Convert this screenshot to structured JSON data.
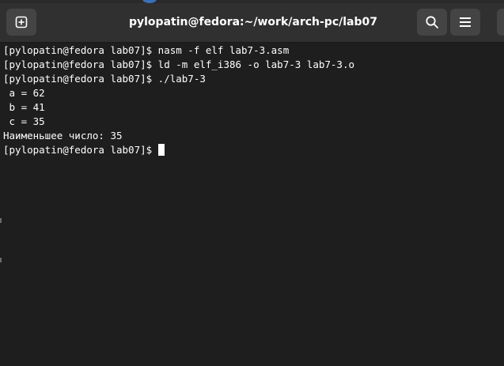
{
  "window": {
    "title": "pylopatin@fedora:~/work/arch-pc/lab07"
  },
  "headerbar": {
    "new_tab_icon": "new-tab-icon",
    "search_icon": "search-icon",
    "menu_icon": "hamburger-menu-icon"
  },
  "terminal": {
    "lines": [
      "[pylopatin@fedora lab07]$ nasm -f elf lab7-3.asm",
      "[pylopatin@fedora lab07]$ ld -m elf_i386 -o lab7-3 lab7-3.o",
      "[pylopatin@fedora lab07]$ ./lab7-3",
      " a = 62",
      " b = 41",
      " c = 35",
      "Наименьшее число: 35"
    ],
    "prompt": "[pylopatin@fedora lab07]$ "
  },
  "colors": {
    "background": "#1e1e1e",
    "headerbar": "#303030",
    "button": "#444444",
    "text": "#ffffff"
  }
}
